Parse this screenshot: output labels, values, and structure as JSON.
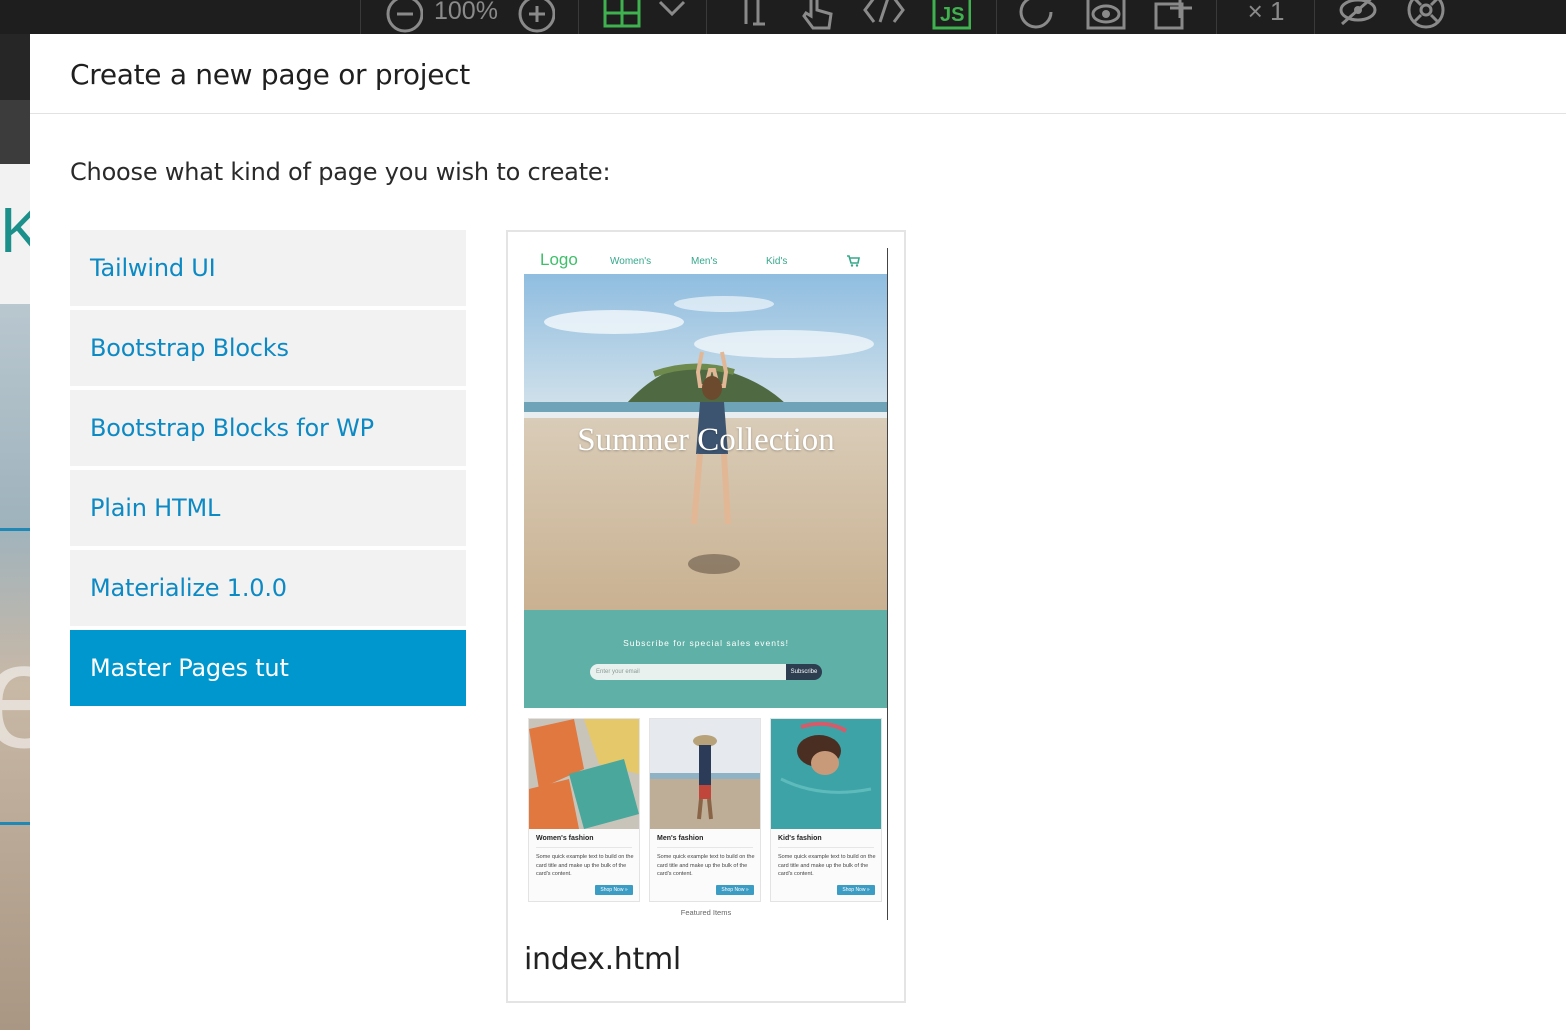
{
  "toolbar": {
    "zoom_value": "100%",
    "device_count": "× 1"
  },
  "background": {
    "left_letter_top": "K",
    "left_letter_bottom": "e"
  },
  "dialog": {
    "title": "Create a new page or project",
    "prompt": "Choose what kind of page you wish to create:",
    "page_types": [
      {
        "label": "Tailwind UI",
        "selected": false
      },
      {
        "label": "Bootstrap Blocks",
        "selected": false
      },
      {
        "label": "Bootstrap Blocks for WP",
        "selected": false
      },
      {
        "label": "Plain HTML",
        "selected": false
      },
      {
        "label": "Materialize 1.0.0",
        "selected": false
      },
      {
        "label": "Master Pages tut",
        "selected": true
      }
    ],
    "template": {
      "filename": "index.html",
      "preview": {
        "logo": "Logo",
        "nav_links": [
          "Women's",
          "Men's",
          "Kid's"
        ],
        "hero_title": "Summer Collection",
        "subscribe_text": "Subscribe for special sales events!",
        "email_placeholder": "Enter your email",
        "subscribe_button": "Subscribe",
        "cards": [
          {
            "title": "Women's fashion",
            "text": "Some quick example text to build on the card title and make up the bulk of the card's content.",
            "button": "Shop Now »"
          },
          {
            "title": "Men's fashion",
            "text": "Some quick example text to build on the card title and make up the bulk of the card's content.",
            "button": "Shop Now »"
          },
          {
            "title": "Kid's fashion",
            "text": "Some quick example text to build on the card title and make up the bulk of the card's content.",
            "button": "Shop Now »"
          }
        ],
        "footer_caption": "Featured Items"
      }
    }
  },
  "colors": {
    "accent": "#0097ce",
    "link_text": "#0d8ac4",
    "list_bg": "#f2f2f2",
    "toolbar_bg": "#1e1e1e",
    "subscribe_bg": "#5fb0a6",
    "toolbar_green": "#3fb24f"
  }
}
